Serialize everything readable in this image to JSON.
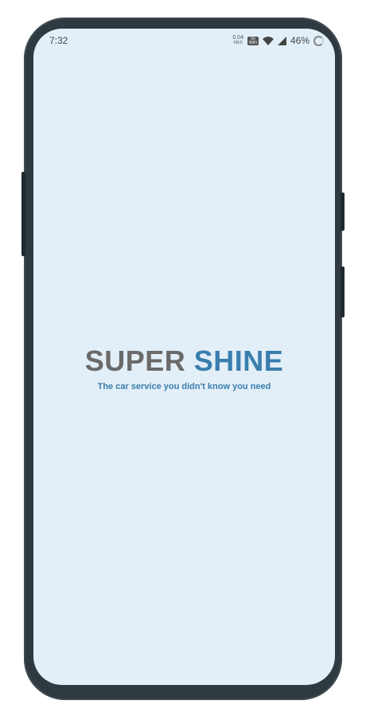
{
  "status_bar": {
    "time": "7:32",
    "net_speed_value": "0.04",
    "net_speed_unit": "KB/S",
    "volte_label": "Vo WiFi",
    "battery_percent": "46%",
    "icons": [
      "wifi-icon",
      "signal-icon",
      "battery-icon"
    ]
  },
  "splash": {
    "title_part1": "SUPER",
    "title_part2": "SHINE",
    "tagline": "The car service you didn't know you need"
  },
  "colors": {
    "background": "#e3eff8",
    "title_grey": "#6a6a6a",
    "brand_blue": "#3a7eae",
    "phone_frame": "#2f3a40"
  }
}
